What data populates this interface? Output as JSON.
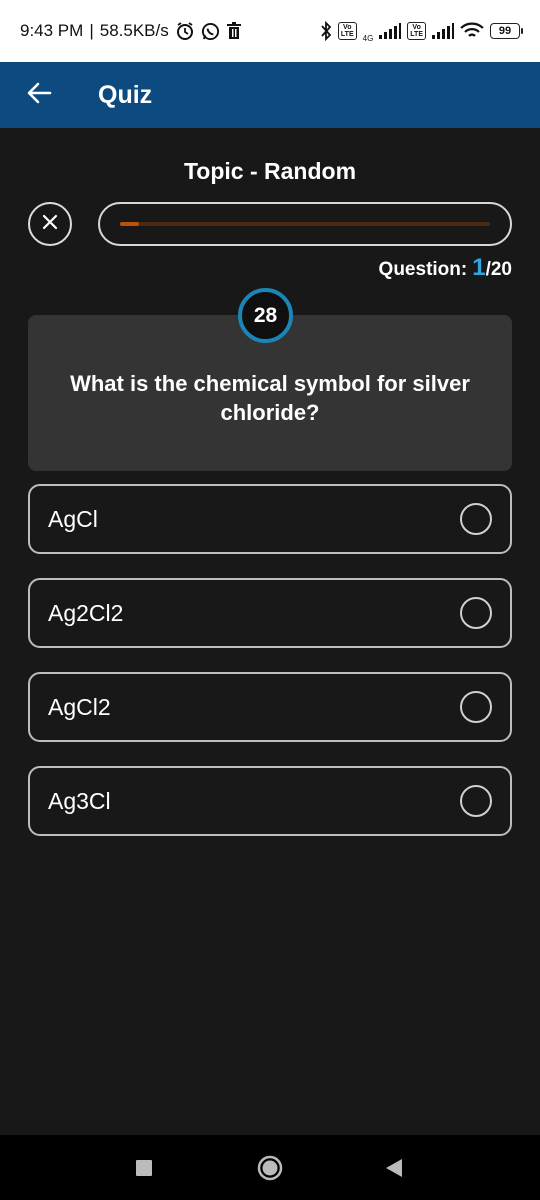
{
  "status_bar": {
    "time": "9:43 PM",
    "separator": "|",
    "speed": "58.5KB/s",
    "network_label": "4G",
    "lte_label_top": "Vo",
    "lte_label_bottom": "LTE",
    "battery": "99",
    "icons": [
      "alarm-icon",
      "whatsapp-icon",
      "trash-icon",
      "bluetooth-icon",
      "signal-icon",
      "wifi-icon",
      "battery-icon"
    ]
  },
  "app_bar": {
    "title": "Quiz",
    "back_icon": "arrow-left-icon",
    "color": "#0d4a80"
  },
  "quiz": {
    "topic": "Topic - Random",
    "question_label": "Question:",
    "current": "1",
    "total_text": "/20",
    "progress": 0.05,
    "timer": "28",
    "question": "What is the chemical symbol for silver chloride?",
    "options": [
      {
        "label": "AgCl"
      },
      {
        "label": "Ag2Cl2"
      },
      {
        "label": "AgCl2"
      },
      {
        "label": "Ag3Cl"
      }
    ]
  },
  "colors": {
    "accent": "#2fa6df",
    "progress_fill": "#c0510b",
    "timer_ring": "#1b86b5",
    "background": "#181818",
    "card": "#343434"
  }
}
